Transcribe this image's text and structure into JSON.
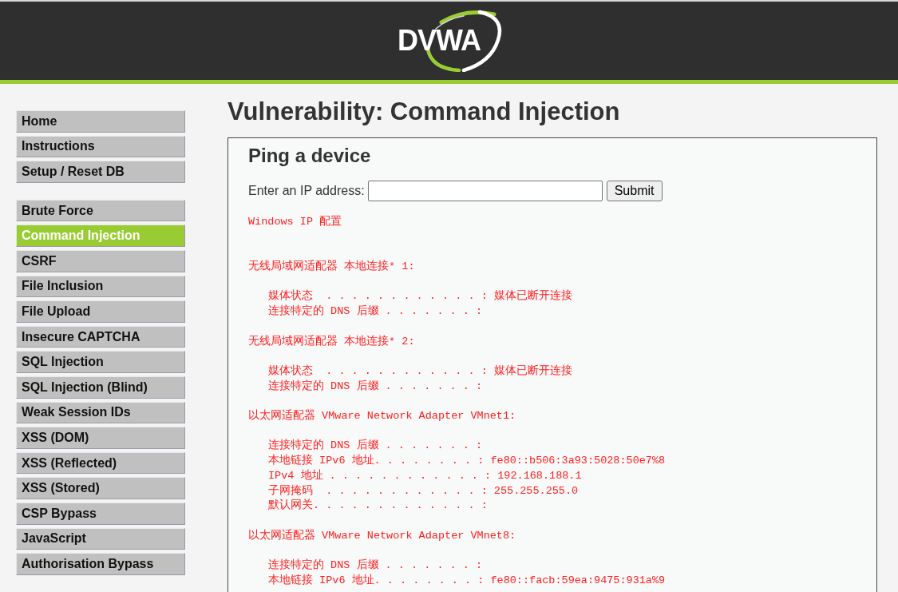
{
  "header": {
    "logo_text": "DVWA"
  },
  "sidebar": {
    "groups": [
      {
        "items": [
          {
            "label": "Home",
            "selected": false
          },
          {
            "label": "Instructions",
            "selected": false
          },
          {
            "label": "Setup / Reset DB",
            "selected": false
          }
        ]
      },
      {
        "items": [
          {
            "label": "Brute Force",
            "selected": false
          },
          {
            "label": "Command Injection",
            "selected": true
          },
          {
            "label": "CSRF",
            "selected": false
          },
          {
            "label": "File Inclusion",
            "selected": false
          },
          {
            "label": "File Upload",
            "selected": false
          },
          {
            "label": "Insecure CAPTCHA",
            "selected": false
          },
          {
            "label": "SQL Injection",
            "selected": false
          },
          {
            "label": "SQL Injection (Blind)",
            "selected": false
          },
          {
            "label": "Weak Session IDs",
            "selected": false
          },
          {
            "label": "XSS (DOM)",
            "selected": false
          },
          {
            "label": "XSS (Reflected)",
            "selected": false
          },
          {
            "label": "XSS (Stored)",
            "selected": false
          },
          {
            "label": "CSP Bypass",
            "selected": false
          },
          {
            "label": "JavaScript",
            "selected": false
          },
          {
            "label": "Authorisation Bypass",
            "selected": false
          }
        ]
      }
    ]
  },
  "page": {
    "title": "Vulnerability: Command Injection"
  },
  "panel": {
    "heading": "Ping a device",
    "form": {
      "label": "Enter an IP address:",
      "button": "Submit"
    },
    "output": [
      {
        "kind": "title",
        "text": "Windows IP 配置"
      },
      {
        "kind": "adapter",
        "text": "无线局域网适配器 本地连接* 1:",
        "lines": [
          "媒体状态  . . . . . . . . . . . . : 媒体已断开连接",
          "连接特定的 DNS 后缀 . . . . . . . :"
        ]
      },
      {
        "kind": "adapter",
        "text": "无线局域网适配器 本地连接* 2:",
        "lines": [
          "媒体状态  . . . . . . . . . . . . : 媒体已断开连接",
          "连接特定的 DNS 后缀 . . . . . . . :"
        ]
      },
      {
        "kind": "adapter",
        "text": "以太网适配器 VMware Network Adapter VMnet1:",
        "lines": [
          "连接特定的 DNS 后缀 . . . . . . . :",
          "本地链接 IPv6 地址. . . . . . . . : fe80::b506:3a93:5028:50e7%8",
          "IPv4 地址 . . . . . . . . . . . . : 192.168.188.1",
          "子网掩码  . . . . . . . . . . . . : 255.255.255.0",
          "默认网关. . . . . . . . . . . . . :"
        ]
      },
      {
        "kind": "adapter",
        "text": "以太网适配器 VMware Network Adapter VMnet8:",
        "lines": [
          "连接特定的 DNS 后缀 . . . . . . . :",
          "本地链接 IPv6 地址. . . . . . . . : fe80::facb:59ea:9475:931a%9"
        ]
      }
    ]
  }
}
